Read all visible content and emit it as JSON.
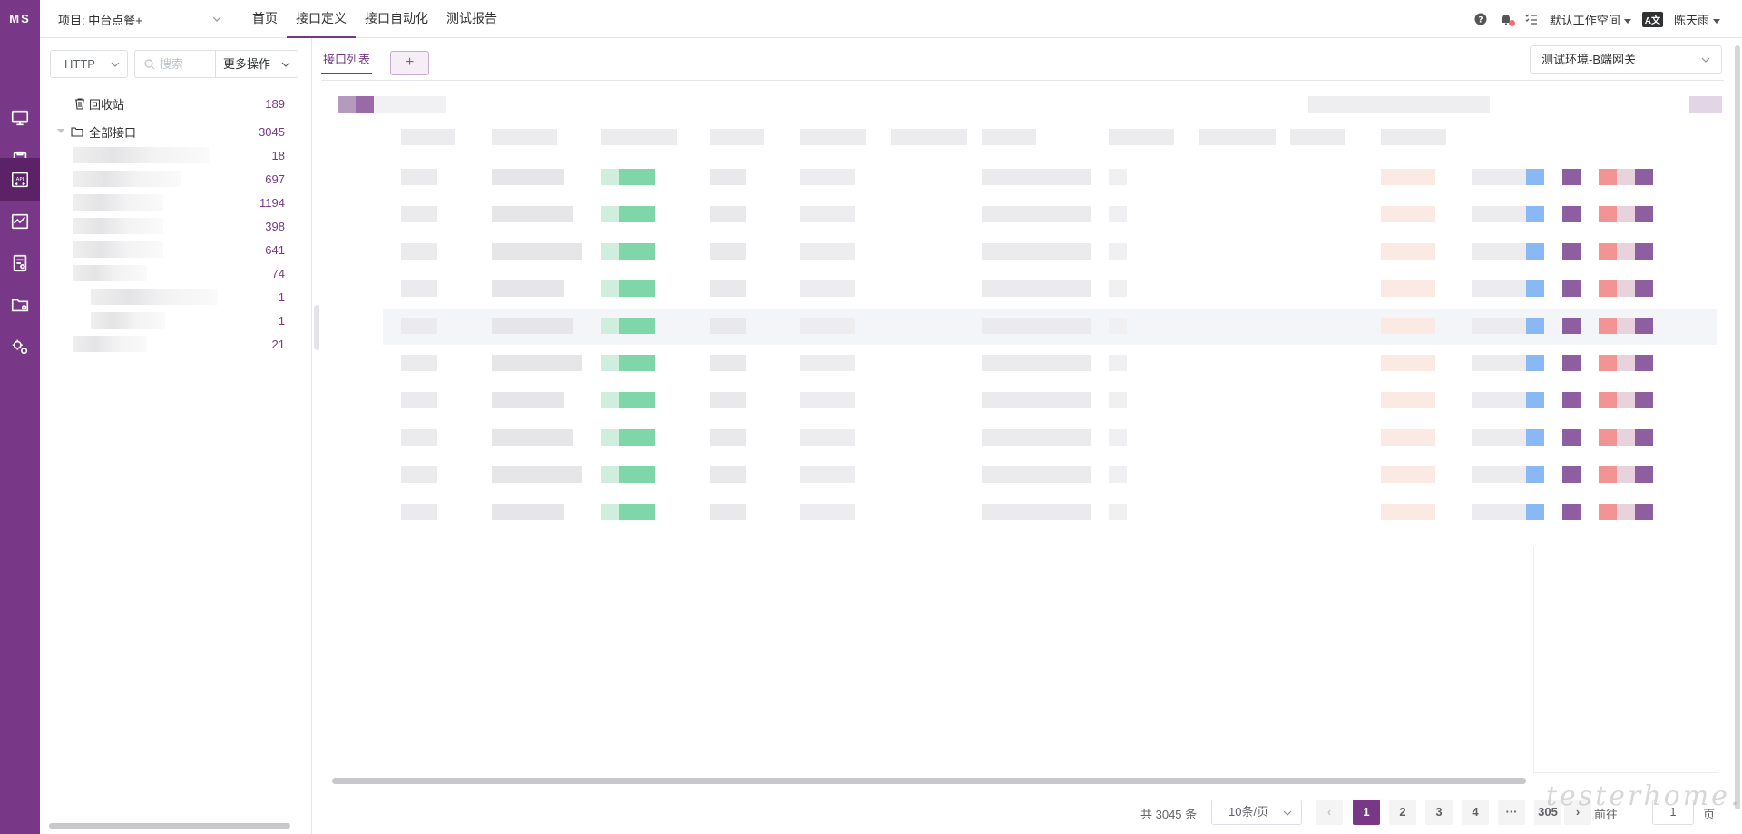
{
  "rail": {
    "logo": "MS",
    "items": [
      {
        "icon": "monitor-icon"
      },
      {
        "icon": "clipboard-icon"
      },
      {
        "icon": "api-icon"
      },
      {
        "icon": "chart-code-icon"
      },
      {
        "icon": "report-icon"
      },
      {
        "icon": "folder-gear-icon"
      },
      {
        "icon": "gears-icon"
      }
    ],
    "active_index": 2
  },
  "topbar": {
    "project_label": "项目: 中台点餐+",
    "nav": [
      {
        "label": "首页",
        "active": false
      },
      {
        "label": "接口定义",
        "active": true
      },
      {
        "label": "接口自动化",
        "active": false
      },
      {
        "label": "测试报告",
        "active": false
      }
    ],
    "workspace": "默认工作空间",
    "lang_badge": "A文",
    "user": "陈天雨"
  },
  "tree": {
    "protocol": "HTTP",
    "search_placeholder": "搜索",
    "more_ops": "更多操作",
    "recycle": {
      "label": "回收站",
      "count": "189"
    },
    "all": {
      "label": "全部接口",
      "count": "3045"
    },
    "children_counts": [
      "18",
      "697",
      "1194",
      "398",
      "641",
      "74",
      "1",
      "1",
      "21"
    ]
  },
  "main": {
    "tab_list": "接口列表",
    "tab_add": "+",
    "environment": "测试环境-B端网关"
  },
  "pagination": {
    "total": "共 3045 条",
    "page_size": "10条/页",
    "pages": [
      "1",
      "2",
      "3",
      "4",
      "···",
      "305"
    ],
    "current": "1",
    "goto_label": "前往",
    "goto_value": "1",
    "goto_unit": "页"
  },
  "watermark": "testerhome.com",
  "colors": {
    "brand": "#783887",
    "count": "#783887",
    "method_green": "#7fd6a8",
    "action_blue": "#8ab8f5",
    "action_purple": "#8d5fa0",
    "action_red": "#f29494"
  }
}
